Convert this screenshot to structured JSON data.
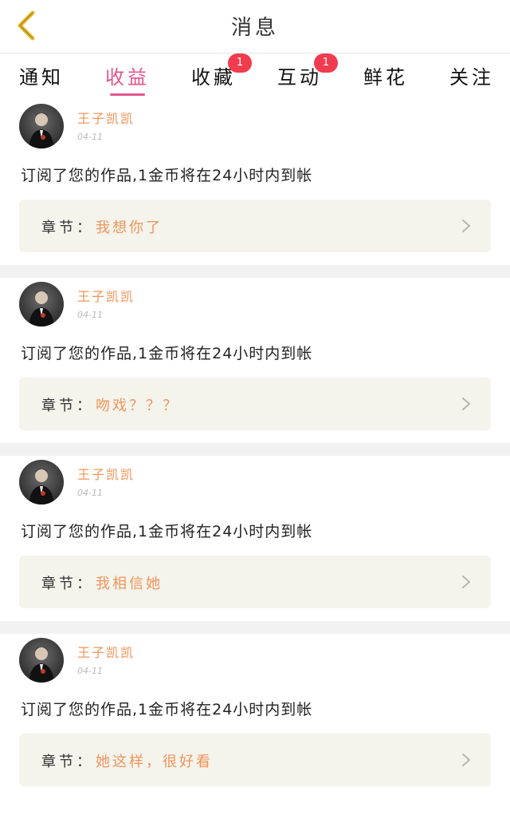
{
  "header": {
    "title": "消息"
  },
  "tabs": [
    {
      "label": "通知",
      "active": false,
      "badge": null
    },
    {
      "label": "收益",
      "active": true,
      "badge": null
    },
    {
      "label": "收藏",
      "active": false,
      "badge": "1"
    },
    {
      "label": "互动",
      "active": false,
      "badge": "1"
    },
    {
      "label": "鲜花",
      "active": false,
      "badge": null
    },
    {
      "label": "关注",
      "active": false,
      "badge": null
    }
  ],
  "colors": {
    "accent": "#e0568e",
    "badge": "#f03c4e",
    "username": "#f0955a",
    "back_arrow": "#e8b92e"
  },
  "messages": [
    {
      "user": "王子凯凯",
      "date": "04-11",
      "text": "订阅了您的作品,1金币将在24小时内到帐",
      "chapter_label": "章节：",
      "chapter_title": "我想你了"
    },
    {
      "user": "王子凯凯",
      "date": "04-11",
      "text": "订阅了您的作品,1金币将在24小时内到帐",
      "chapter_label": "章节：",
      "chapter_title": "吻戏？？？"
    },
    {
      "user": "王子凯凯",
      "date": "04-11",
      "text": "订阅了您的作品,1金币将在24小时内到帐",
      "chapter_label": "章节：",
      "chapter_title": "我相信她"
    },
    {
      "user": "王子凯凯",
      "date": "04-11",
      "text": "订阅了您的作品,1金币将在24小时内到帐",
      "chapter_label": "章节：",
      "chapter_title": "她这样，很好看"
    }
  ]
}
